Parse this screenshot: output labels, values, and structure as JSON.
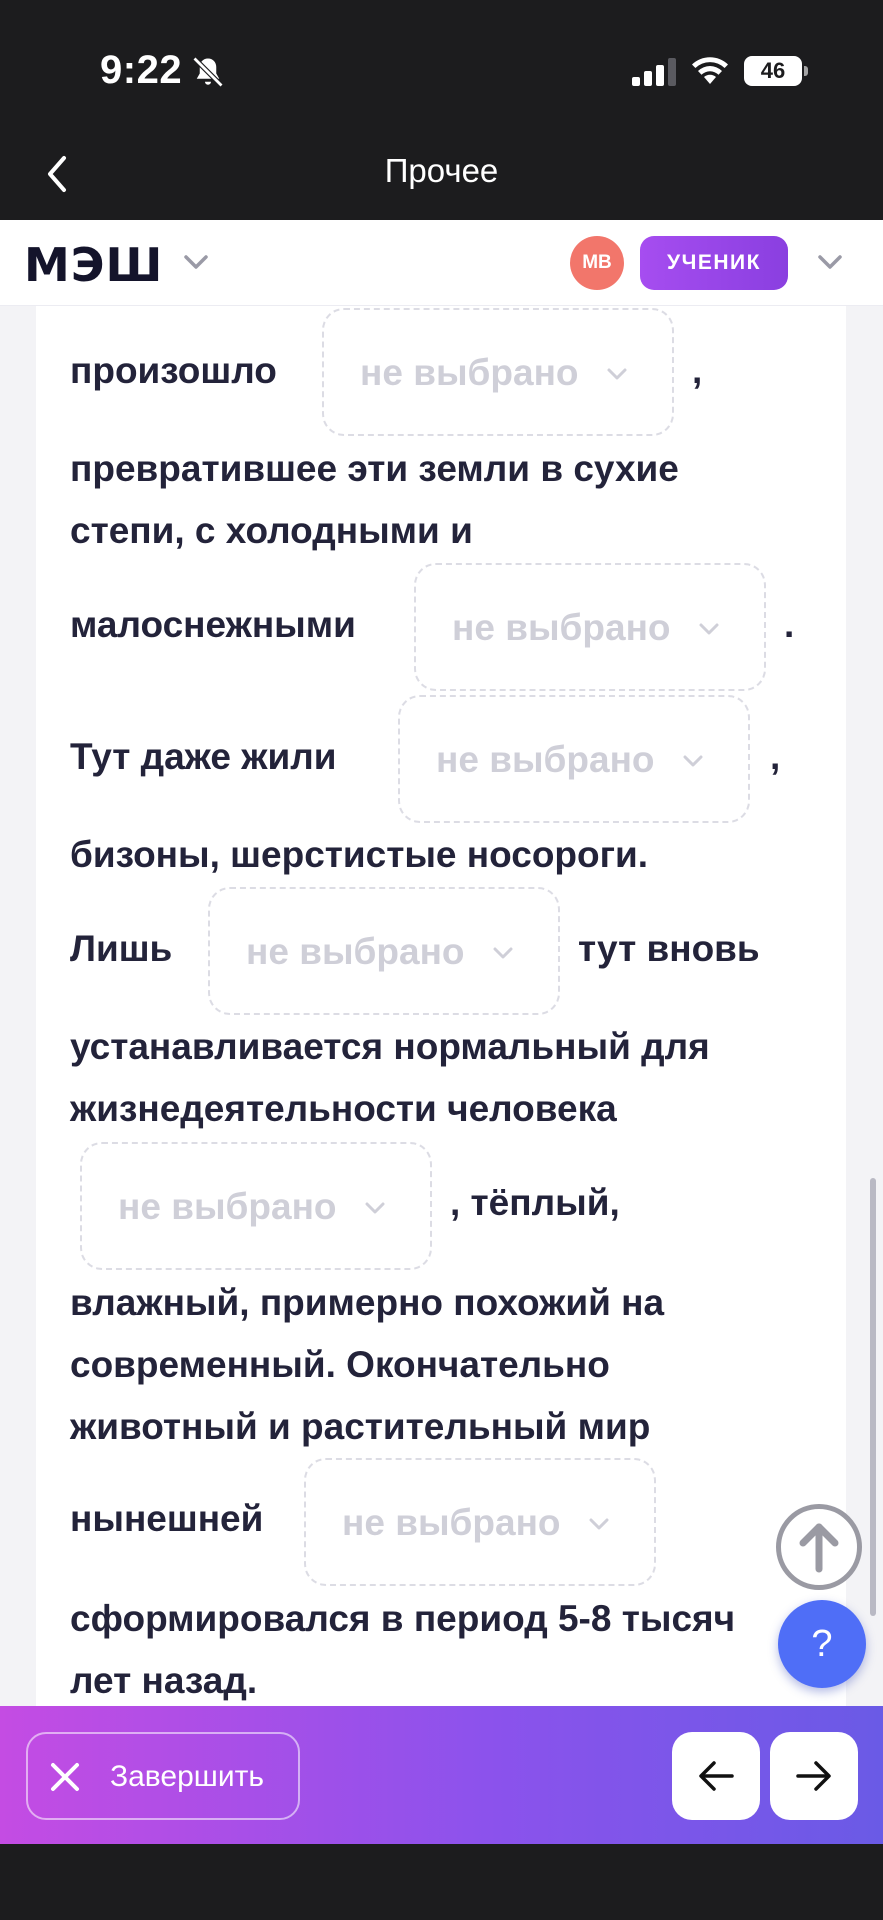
{
  "status_bar": {
    "time": "9:22",
    "battery": "46",
    "icons": [
      "bell-slash-icon",
      "signal-icon",
      "wifi-icon",
      "battery-icon"
    ]
  },
  "nav": {
    "title": "Прочее",
    "back_icon": "chevron-left-icon"
  },
  "header": {
    "logo": "МЭШ",
    "avatar_initials": "МВ",
    "role": "УЧЕНИК",
    "colors": {
      "avatar": "#f2766b",
      "role": "#a64df0"
    }
  },
  "content": {
    "text": [
      "произошло",
      ",",
      "превратившее эти земли в сухие",
      "степи, с холодными и",
      "малоснежными",
      ".",
      "Тут даже жили",
      ",",
      "бизоны, шерстистые носороги.",
      "Лишь",
      "тут вновь",
      "устанавливается нормальный для",
      "жизнедеятельности человека",
      ", тёплый,",
      "влажный, примерно похожий на",
      "современный. Окончательно",
      "животный и растительный мир",
      "нынешней",
      "сформировался в период 5-8 тысяч",
      "лет назад."
    ],
    "dropdowns": [
      "не выбрано",
      "не выбрано",
      "не выбрано",
      "не выбрано",
      "не выбрано",
      "не выбрано"
    ]
  },
  "floating": {
    "scroll_top_icon": "arrow-up-circle-icon",
    "help_label": "?"
  },
  "bottom_bar": {
    "finish_label": "Завершить",
    "prev_icon": "arrow-left-icon",
    "next_icon": "arrow-right-icon",
    "gradient": [
      "#c44ce3",
      "#6a5ae6"
    ]
  }
}
